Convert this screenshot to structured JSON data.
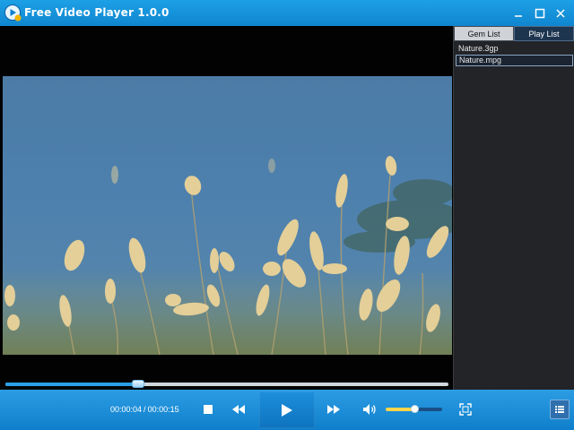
{
  "window": {
    "title": "Free Video Player 1.0.0"
  },
  "playlist_panel": {
    "tabs": [
      {
        "label": "Gem List",
        "active": false
      },
      {
        "label": "Play List",
        "active": true
      }
    ],
    "items": [
      {
        "name": "Nature.3gp",
        "selected": false
      },
      {
        "name": "Nature.mpg",
        "selected": true
      }
    ]
  },
  "playback": {
    "current_time": "00:00:04",
    "separator": "/",
    "total_time": "00:00:15",
    "progress_fraction": 0.3,
    "volume_fraction": 0.5
  },
  "icons": {
    "app": "play-disc-icon",
    "minimize": "minimize-icon",
    "maximize": "maximize-icon",
    "close": "close-icon",
    "stop": "stop-icon",
    "previous": "rewind-icon",
    "play": "play-icon",
    "next": "fast-forward-icon",
    "volume": "speaker-icon",
    "fullscreen": "fullscreen-icon",
    "playlist_toggle": "list-icon"
  },
  "colors": {
    "accent": "#1592dc",
    "titlebar": "#129ae0",
    "panel_bg": "#222428",
    "video_bg": "#020202",
    "volume_fill": "#ffd54a"
  }
}
